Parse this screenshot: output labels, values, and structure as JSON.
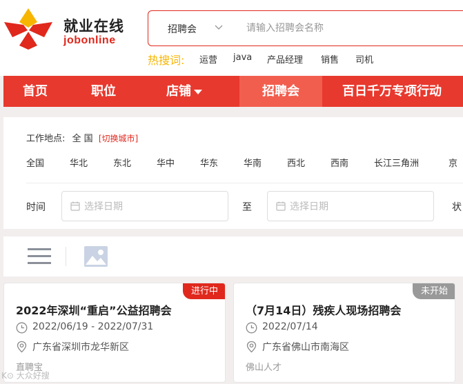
{
  "brand": {
    "name_cn": "就业在线",
    "name_en": "jobonline",
    "colors": {
      "primary": "#e0281d",
      "accent": "#f7b500"
    }
  },
  "search": {
    "type_label": "招聘会",
    "placeholder": "请输入招聘会名称",
    "hot_label": "热搜词:",
    "hot_words": [
      "运营",
      "java",
      "产品经理",
      "销售",
      "司机"
    ]
  },
  "nav": {
    "items": [
      "首页",
      "职位",
      "店铺",
      "招聘会",
      "百日千万专项行动"
    ],
    "active": "招聘会"
  },
  "filter": {
    "location_label": "工作地点:",
    "location_value": "全 国",
    "switch_city": "[切换城市]",
    "regions": [
      "全国",
      "华北",
      "东北",
      "华中",
      "华东",
      "华南",
      "西北",
      "西南",
      "长江三角洲",
      "京"
    ],
    "time_label": "时间",
    "to_label": "至",
    "date_placeholder": "选择日期",
    "status_label_partial": "状"
  },
  "view_toggle": {
    "icons": [
      "list-view-icon",
      "image-view-icon"
    ]
  },
  "cards": [
    {
      "status": "进行中",
      "status_color": "#e0281d",
      "title": "2022年深圳“重启”公益招聘会",
      "date": "2022/06/19 - 2022/07/31",
      "location": "广东省深圳市龙华新区",
      "organizer": "直聘宝"
    },
    {
      "status": "未开始",
      "status_color": "#999999",
      "title": "（7月14日）残疾人现场招聘会",
      "date": "2022/07/14",
      "location": "广东省佛山市南海区",
      "organizer": "佛山人才"
    }
  ],
  "watermark": "K⊙ 大众好搜"
}
